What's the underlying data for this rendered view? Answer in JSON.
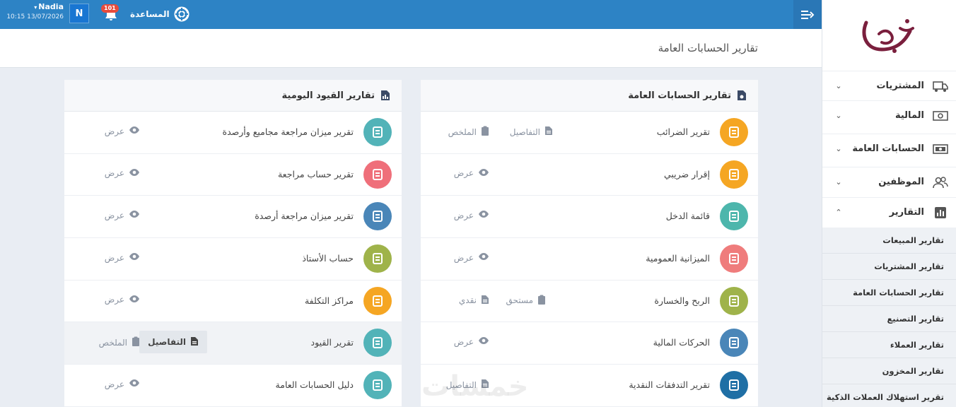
{
  "topbar": {
    "user_name": "Nadia",
    "user_datetime": "10:15 13/07/2026",
    "avatar_letter": "N",
    "notification_count": "101",
    "help_label": "المساعدة"
  },
  "page_title": "تقارير الحسابات العامة",
  "sidebar": {
    "items": [
      {
        "label": "المشتريات",
        "icon": "truck-icon"
      },
      {
        "label": "المالية",
        "icon": "cash-icon"
      },
      {
        "label": "الحسابات العامة",
        "icon": "money-icon"
      },
      {
        "label": "الموظفين",
        "icon": "users-icon"
      },
      {
        "label": "التقارير",
        "icon": "chart-icon"
      }
    ],
    "sub_items": [
      "تقارير المبيعات",
      "تقارير المشتريات",
      "تقارير الحسابات العامة",
      "تقارير التصنيع",
      "تقارير العملاء",
      "تقارير المخزون",
      "تقرير استهلاك العملات الذكية"
    ]
  },
  "cards": {
    "right": {
      "title": "تقارير الحسابات العامة",
      "rows": [
        {
          "label": "تقرير الضرائب",
          "a1": "التفاصيل",
          "a2": "الملخص",
          "color": "#f5a623"
        },
        {
          "label": "إقرار ضريبي",
          "a1": "عرض",
          "color": "#f5a623"
        },
        {
          "label": "قائمة الدخل",
          "a1": "عرض",
          "color": "#4db6ac"
        },
        {
          "label": "الميزانية العمومية",
          "a1": "عرض",
          "color": "#ef7c7c"
        },
        {
          "label": "الربح والخسارة",
          "a1": "مستحق",
          "a2": "نقدي",
          "color": "#9fb34a"
        },
        {
          "label": "الحركات المالية",
          "a1": "عرض",
          "color": "#4a86b8"
        },
        {
          "label": "تقرير التدفقات النقدية",
          "a1": "التفاصيل",
          "color": "#1f6fa5"
        }
      ]
    },
    "left": {
      "title": "تقارير القيود اليومية",
      "rows": [
        {
          "label": "تقرير ميزان مراجعة مجاميع وأرصدة",
          "a1": "عرض",
          "color": "#52b3b8"
        },
        {
          "label": "تقرير حساب مراجعة",
          "a1": "عرض",
          "color": "#ef6f7a"
        },
        {
          "label": "تقرير ميزان مراجعة أرصدة",
          "a1": "عرض",
          "color": "#4a86b8"
        },
        {
          "label": "حساب الأستاذ",
          "a1": "عرض",
          "color": "#9fb34a"
        },
        {
          "label": "مراكز التكلفة",
          "a1": "عرض",
          "color": "#f5a623"
        },
        {
          "label": "تقرير القيود",
          "a1": "التفاصيل",
          "a2": "الملخص",
          "color": "#52b3b8"
        },
        {
          "label": "دليل الحسابات العامة",
          "a1": "عرض",
          "color": "#52b3b8"
        }
      ]
    }
  },
  "watermark": "خمسات"
}
